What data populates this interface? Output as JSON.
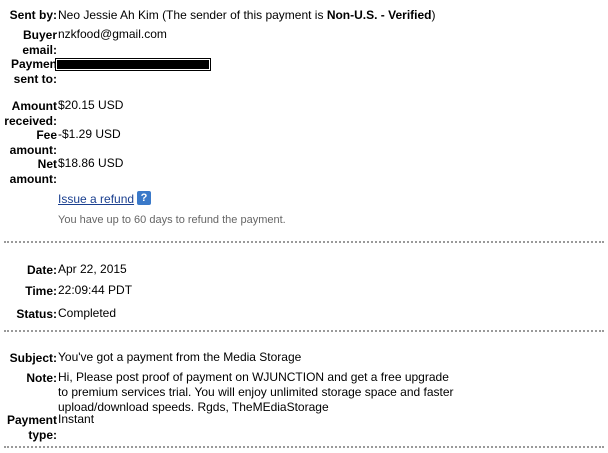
{
  "sender": {
    "label": "Sent by:",
    "name": "Neo Jessie Ah Kim",
    "note_prefix": "(The sender of this payment is ",
    "status": "Non-U.S. - Verified",
    "note_suffix": ")"
  },
  "buyer_email": {
    "label": "Buyer email:",
    "value": "nzkfood@gmail.com"
  },
  "payment_sent_to": {
    "label": "Payment sent to:",
    "label_visible": "Paymen",
    "label_line2": "sent to:"
  },
  "amount_received": {
    "label": "Amount received:",
    "value": "$20.15 USD"
  },
  "fee_amount": {
    "label": "Fee amount:",
    "value": "-$1.29 USD"
  },
  "net_amount": {
    "label": "Net amount:",
    "value": "$18.86 USD"
  },
  "refund": {
    "link_label": "Issue a refund",
    "help_icon": "help-icon",
    "help_glyph": "?",
    "note": "You have up to 60 days to refund the payment."
  },
  "date": {
    "label": "Date:",
    "value": "Apr 22, 2015"
  },
  "time": {
    "label": "Time:",
    "value": "22:09:44 PDT"
  },
  "status": {
    "label": "Status:",
    "value": "Completed"
  },
  "subject": {
    "label": "Subject:",
    "value": "You've got a payment from the Media Storage"
  },
  "note": {
    "label": "Note:",
    "value": "Hi, Please post proof of payment on WJUNCTION and get a free upgrade to premium services trial. You will enjoy unlimited storage space and faster upload/download speeds. Rgds, TheMEdiaStorage"
  },
  "payment_type": {
    "label": "Payment type:",
    "value": "Instant"
  },
  "colors": {
    "link": "#1a3f8f",
    "help_icon_bg": "#3a79c9",
    "muted_text": "#666666",
    "divider": "#999999"
  }
}
